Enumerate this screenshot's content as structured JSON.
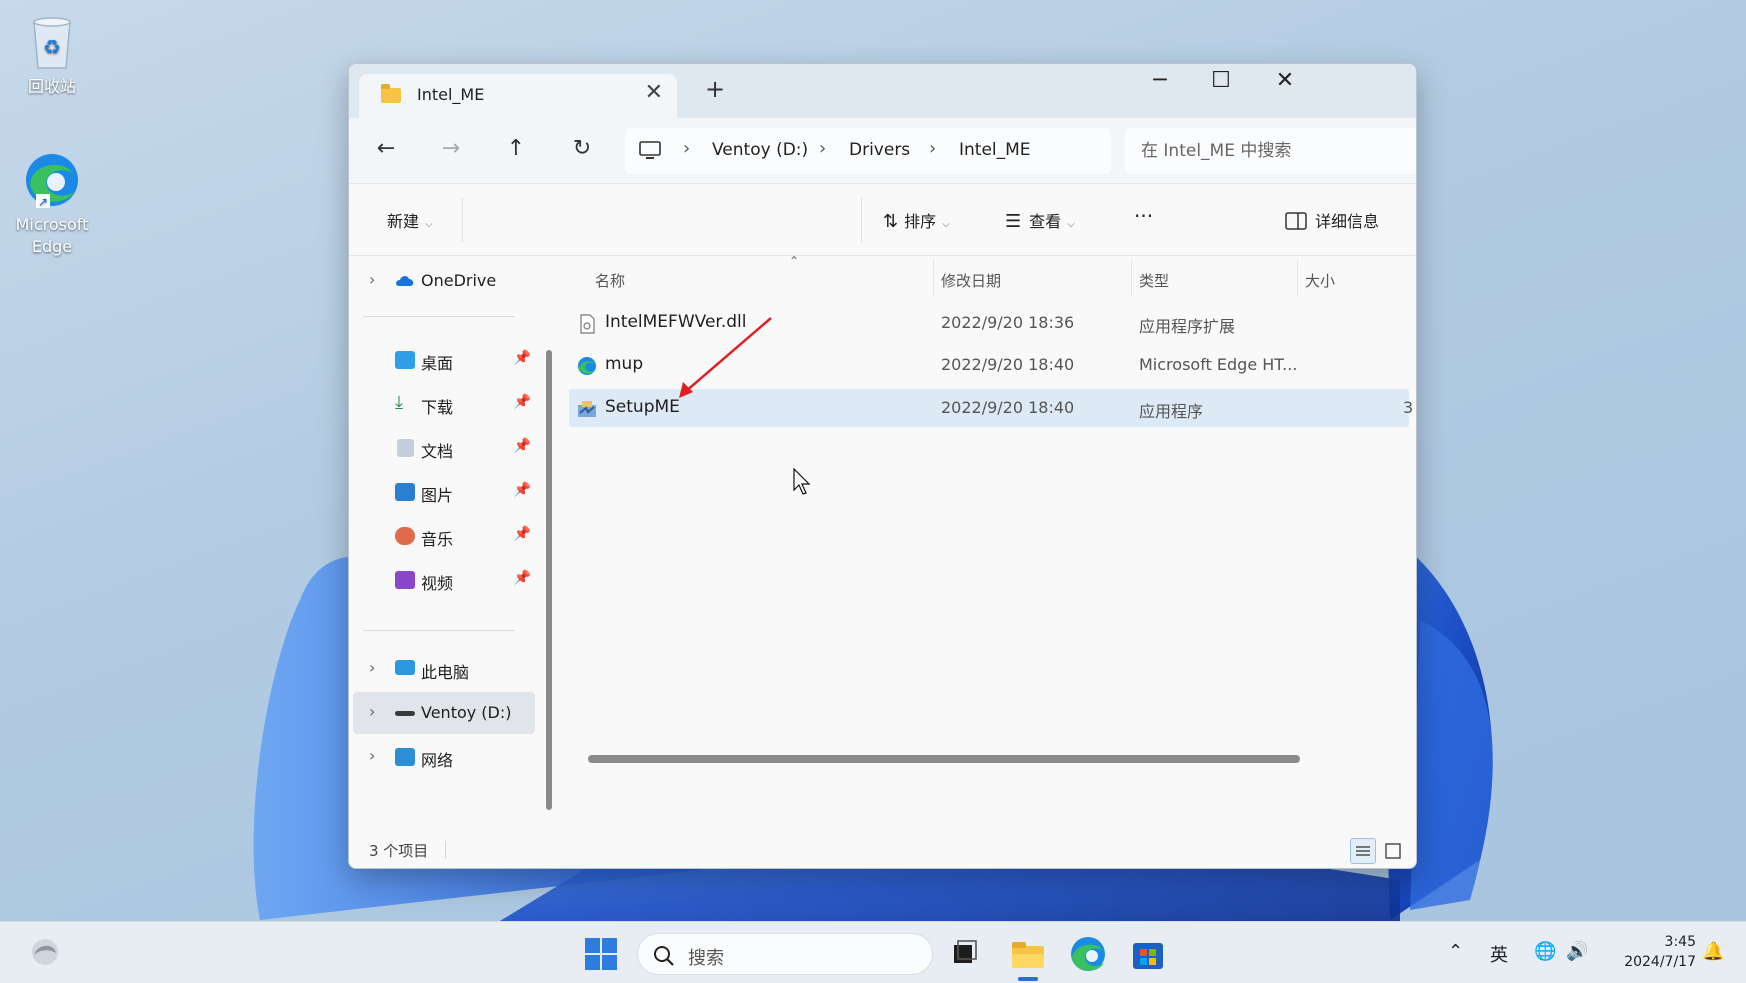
{
  "desktop": {
    "icons": [
      {
        "label": "回收站"
      },
      {
        "label": "Microsoft Edge"
      }
    ]
  },
  "window": {
    "tab_title": "Intel_ME",
    "close_tab_glyph": "✕",
    "new_tab_glyph": "+",
    "controls": {
      "minimize": "─",
      "maximize": "☐",
      "close": "✕"
    }
  },
  "navigation": {
    "back": "←",
    "forward": "→",
    "up": "↑",
    "refresh": "↻",
    "breadcrumb": [
      "Ventoy (D:)",
      "Drivers",
      "Intel_ME"
    ],
    "separator": "›",
    "search_placeholder": "在 Intel_ME 中搜索"
  },
  "commandbar": {
    "new_label": "新建",
    "sort_label": "排序",
    "view_label": "查看",
    "more_glyph": "···",
    "details_label": "详细信息"
  },
  "sidebar": {
    "onedrive": "OneDrive",
    "quick_access": [
      {
        "label": "桌面",
        "icon": "desktop-icon",
        "color": "#2e9ee6"
      },
      {
        "label": "下载",
        "icon": "download-icon",
        "color": "#1f8a4c"
      },
      {
        "label": "文档",
        "icon": "document-icon",
        "color": "#8c9aad"
      },
      {
        "label": "图片",
        "icon": "pictures-icon",
        "color": "#2a7fd3"
      },
      {
        "label": "音乐",
        "icon": "music-icon",
        "color": "#e06b4a"
      },
      {
        "label": "视频",
        "icon": "video-icon",
        "color": "#8a48c8"
      }
    ],
    "this_pc": "此电脑",
    "ventoy": "Ventoy (D:)",
    "network": "网络"
  },
  "filelist": {
    "columns": {
      "name": "名称",
      "modified": "修改日期",
      "type": "类型",
      "size": "大小"
    },
    "rows": [
      {
        "name": "IntelMEFWVer.dll",
        "modified": "2022/9/20 18:36",
        "type": "应用程序扩展",
        "size": "",
        "icon": "dll-file-icon"
      },
      {
        "name": "mup",
        "modified": "2022/9/20 18:40",
        "type": "Microsoft Edge HT...",
        "size": "",
        "icon": "edge-html-file-icon"
      },
      {
        "name": "SetupME",
        "modified": "2022/9/20 18:40",
        "type": "应用程序",
        "size": "3",
        "icon": "setup-exe-icon"
      }
    ]
  },
  "status": {
    "item_count": "3 个项目"
  },
  "taskbar": {
    "search_placeholder": "搜索",
    "ime": "英",
    "time": "3:45",
    "date": "2024/7/17"
  },
  "colors": {
    "accent": "#2b6cd4",
    "selection": "#dde9f5",
    "window_bg": "#f9f9f9",
    "titlebar": "#dfe7ef"
  }
}
